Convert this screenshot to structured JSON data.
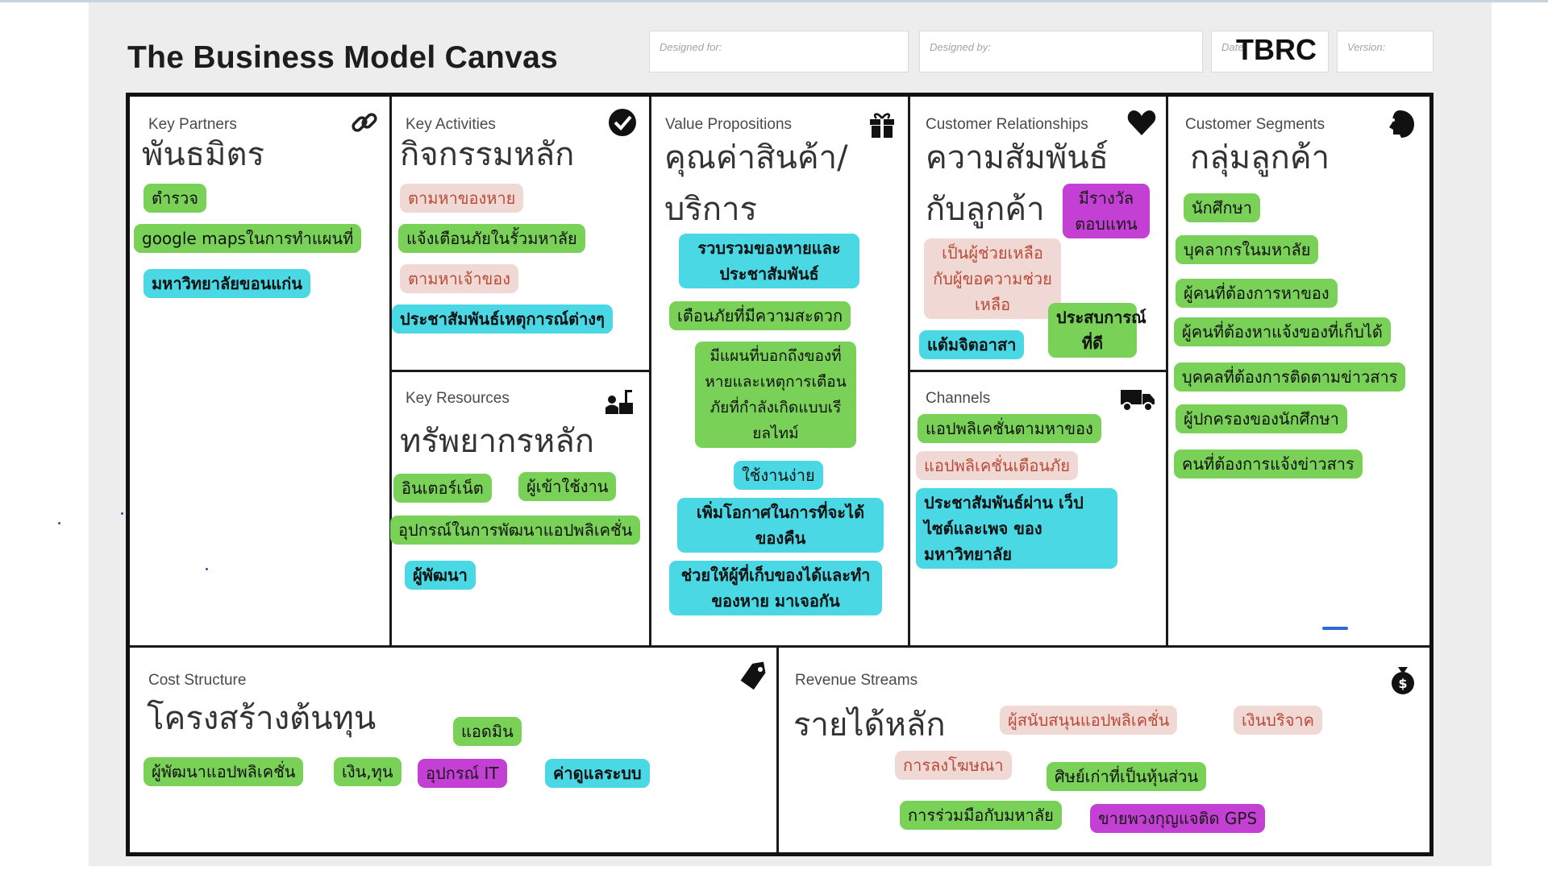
{
  "canvas_title": "The Business Model Canvas",
  "header": {
    "designed_for": "Designed for:",
    "designed_by": "Designed by:",
    "date": "Date",
    "stamp": "TBRC",
    "version": "Version:"
  },
  "blocks": {
    "key_partners": {
      "title": "Key Partners",
      "thai": "พันธมิตร",
      "icon": "link-icon",
      "notes": [
        "ตำรวจ",
        "google mapsในการทำแผนที่",
        "มหาวิทยาลัยขอนแก่น"
      ]
    },
    "key_activities": {
      "title": "Key Activities",
      "thai": "กิจกรรมหลัก",
      "icon": "check-circle-icon",
      "notes": [
        "ตามหาของหาย",
        "แจ้งเตือนภัยในรั้วมหาลัย",
        "ตามหาเจ้าของ",
        "ประชาสัมพันธ์เหตุการณ์ต่างๆ"
      ]
    },
    "key_resources": {
      "title": "Key Resources",
      "thai": "ทรัพยากรหลัก",
      "icon": "worker-icon",
      "notes": [
        "อินเตอร์เน็ต",
        "ผู้เข้าใช้งาน",
        "อุปกรณ์ในการพัฒนาแอปพลิเคชั่น",
        "ผู้พัฒนา"
      ]
    },
    "value_propositions": {
      "title": "Value Propositions",
      "thai": "คุณค่าสินค้า/",
      "thai2": "บริการ",
      "icon": "gift-icon",
      "notes": [
        "รวบรวมของหายและประชาสัมพันธ์",
        "เตือนภัยที่มีความสะดวก",
        "มีแผนที่บอกถึงของที่หายและเหตุการเตือนภัยที่กำลังเกิดแบบเรียลไทม์",
        "ใช้งานง่าย",
        "เพิ่มโอกาศในการที่จะได้ของคืน",
        "ช่วยให้ผู้ที่เก็บของได้และทำของหาย มาเจอกัน"
      ]
    },
    "customer_relationships": {
      "title": "Customer Relationships",
      "thai": "ความสัมพันธ์",
      "thai2": "กับลูกค้า",
      "icon": "heart-icon",
      "notes": [
        "มีรางวัลตอบแทน",
        "เป็นผู้ช่วยเหลือกับผู้ขอความช่วยเหลือ",
        "แต้มจิตอาสา",
        "ประสบการณ์ที่ดี"
      ]
    },
    "channels": {
      "title": "Channels",
      "icon": "truck-icon",
      "notes": [
        "แอปพลิเคชั่นตามหาของ",
        "แอปพลิเคชั่นเตือนภัย",
        "ประชาสัมพันธ์ผ่าน เว็ปไซต์และเพจ ของมหาวิทยาลัย"
      ]
    },
    "customer_segments": {
      "title": "Customer Segments",
      "thai": "กลุ่มลูกค้า",
      "icon": "head-icon",
      "notes": [
        "นักศึกษา",
        "บุคลากรในมหาลัย",
        "ผู้คนที่ต้องการหาของ",
        "ผู้คนที่ต้องหาแจ้งของที่เก็บได้",
        "บุคคลที่ต้องการติดตามข่าวสาร",
        "ผู้ปกครองของนักศึกษา",
        "คนที่ต้องการแจ้งข่าวสาร"
      ]
    },
    "cost_structure": {
      "title": "Cost Structure",
      "thai": "โครงสร้างต้นทุน",
      "icon": "price-tag-icon",
      "notes": [
        "แอดมิน",
        "ผู้พัฒนาแอปพลิเคชั่น",
        "เงิน,ทุน",
        "อุปกรณ์ IT",
        "ค่าดูแลระบบ"
      ]
    },
    "revenue_streams": {
      "title": "Revenue Streams",
      "thai": "รายได้หลัก",
      "icon": "money-bag-icon",
      "notes": [
        "ผู้สนับสนุนแอปพลิเคชั่น",
        "เงินบริจาค",
        "การลงโฆษณา",
        "ศิษย์เก่าที่เป็นหุ้นส่วน",
        "การร่วมมือกับมหาลัย",
        "ขายพวงกุญแจติด GPS"
      ]
    }
  },
  "colors": {
    "green_note": "#79d157",
    "cyan_note": "#49d8e4",
    "pink_note": "#f0d9d4",
    "pink_text": "#b94b37",
    "purple_note": "#c43fd4",
    "board_border": "#111111"
  }
}
